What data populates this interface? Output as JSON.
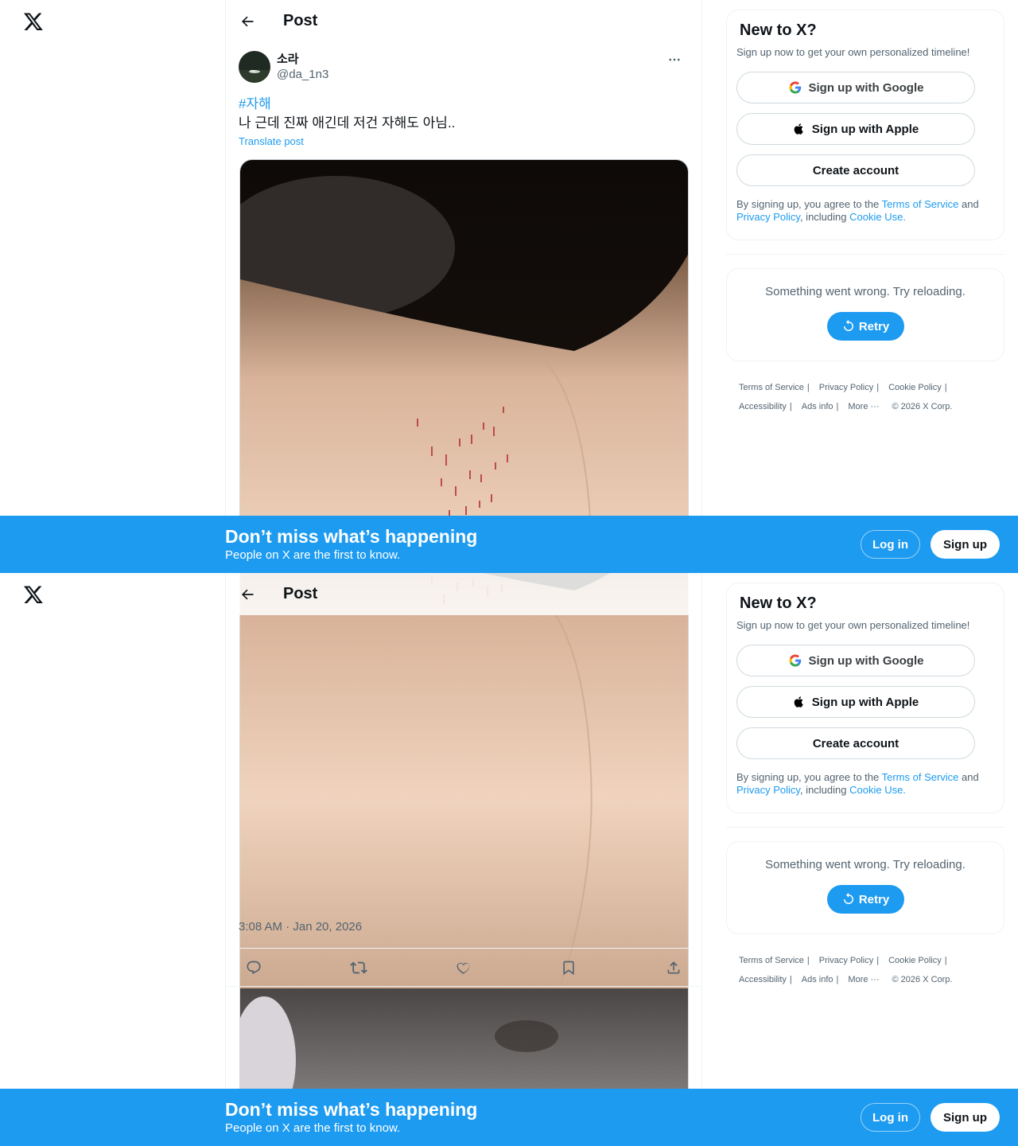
{
  "page": {
    "title": "Post"
  },
  "post": {
    "display_name": "소라",
    "handle": "@da_1n3",
    "hashtag": "#자해",
    "text": "나 근데 진짜 애긴데 저건 자해도 아님..",
    "translate": "Translate post",
    "timestamp": "3:08 AM · Jan 20, 2026"
  },
  "signup": {
    "title": "New to X?",
    "subtitle": "Sign up now to get your own personalized timeline!",
    "google": "Sign up with Google",
    "apple": "Sign up with Apple",
    "create": "Create account",
    "legal_prefix": "By signing up, you agree to the ",
    "terms": "Terms of Service",
    "and": " and ",
    "privacy": "Privacy Policy",
    "including": ", including ",
    "cookie": "Cookie Use."
  },
  "error": {
    "message": "Something went wrong. Try reloading.",
    "retry": "Retry"
  },
  "footer": {
    "terms": "Terms of Service",
    "privacy": "Privacy Policy",
    "cookie": "Cookie Policy",
    "accessibility": "Accessibility",
    "ads": "Ads info",
    "more": "More ···",
    "copyright": "© 2026 X Corp."
  },
  "banner": {
    "title": "Don’t miss what’s happening",
    "subtitle": "People on X are the first to know.",
    "login": "Log in",
    "signup": "Sign up"
  },
  "colors": {
    "accent": "#1d9bf0",
    "text": "#0f1419",
    "muted": "#536471"
  },
  "icons": [
    "x-logo-icon",
    "back-arrow-icon",
    "more-icon",
    "reply-icon",
    "repost-icon",
    "like-icon",
    "bookmark-icon",
    "share-icon",
    "google-icon",
    "apple-icon",
    "retry-icon"
  ]
}
